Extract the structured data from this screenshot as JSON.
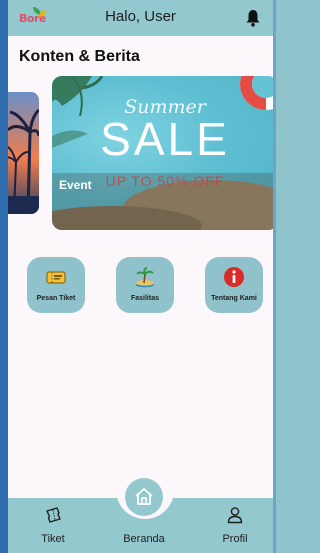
{
  "header": {
    "logo_text": "Bore",
    "greeting": "Halo, User",
    "notification_icon": "bell-icon"
  },
  "content": {
    "section_title": "Konten & Berita",
    "carousel": {
      "active_slide": {
        "script_title": "Summer",
        "headline": "SALE",
        "offer": "UP TO 50% OFF",
        "caption": "Event"
      }
    }
  },
  "menu": [
    {
      "label": "Pesan Tiket",
      "icon": "ticket-icon"
    },
    {
      "label": "Fasilitas",
      "icon": "island-icon"
    },
    {
      "label": "Tentang Kami",
      "icon": "info-icon"
    }
  ],
  "bottom_nav": [
    {
      "label": "Tiket",
      "icon": "ticket-icon"
    },
    {
      "label": "Beranda",
      "icon": "home-icon",
      "active": true
    },
    {
      "label": "Profil",
      "icon": "user-icon"
    }
  ],
  "colors": {
    "accent": "#93c8cf",
    "background": "#fbf7fa",
    "info_red": "#d92b2b"
  }
}
